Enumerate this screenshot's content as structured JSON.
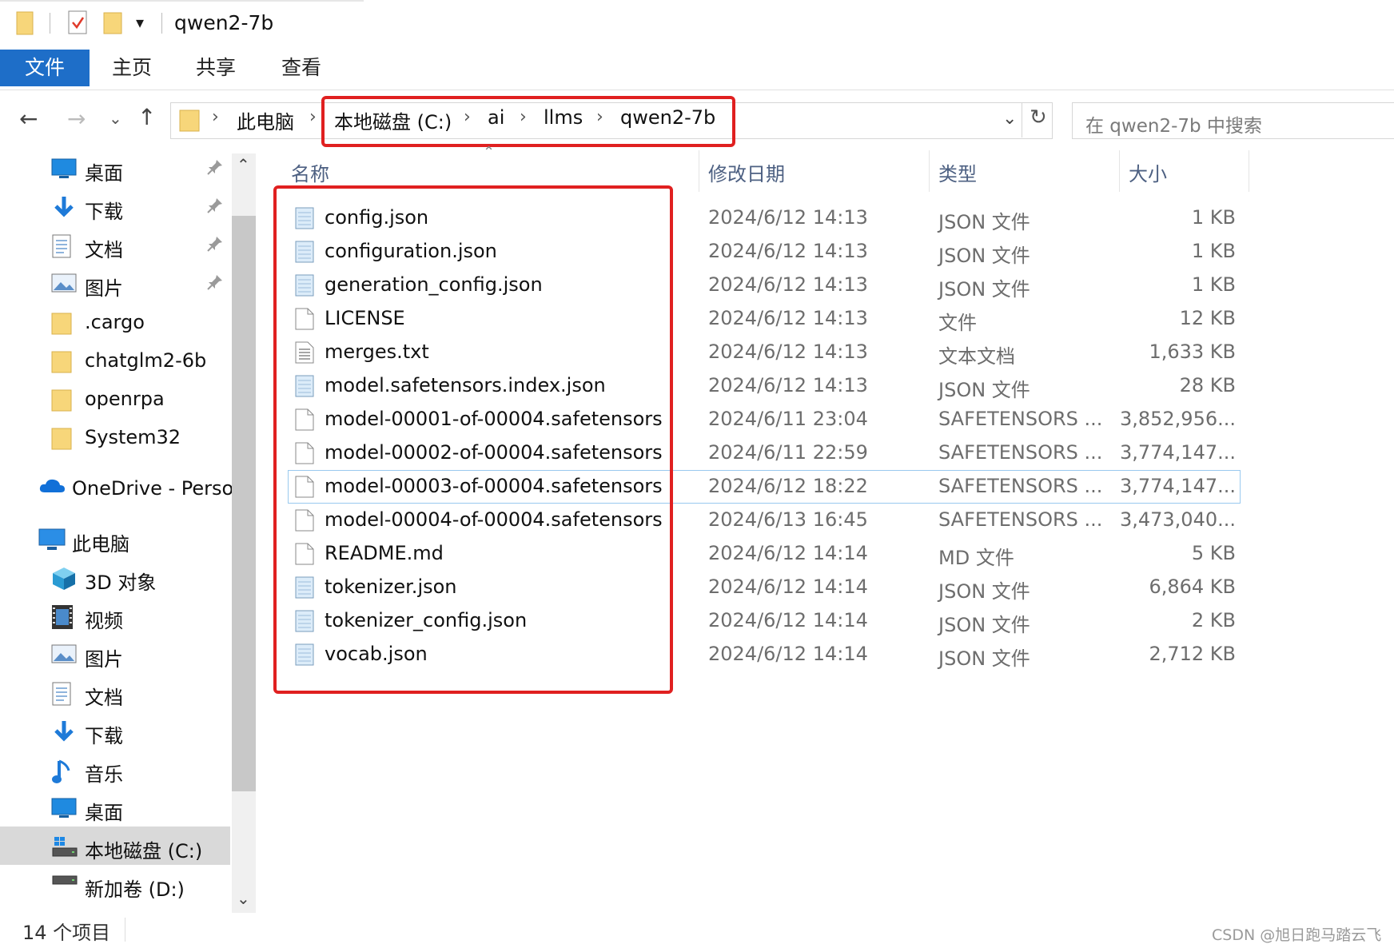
{
  "window": {
    "title": "qwen2-7b"
  },
  "ribbon": {
    "tabs": [
      {
        "label": "文件"
      },
      {
        "label": "主页"
      },
      {
        "label": "共享"
      },
      {
        "label": "查看"
      }
    ]
  },
  "address": {
    "crumbs": [
      "此电脑",
      "本地磁盘 (C:)",
      "ai",
      "llms",
      "qwen2-7b"
    ],
    "search_placeholder": "在 qwen2-7b 中搜索"
  },
  "columns": {
    "name": "名称",
    "date": "修改日期",
    "type": "类型",
    "size": "大小"
  },
  "nav": {
    "quick_access": [
      {
        "label": "桌面",
        "icon": "desktop-icon",
        "pinned": true
      },
      {
        "label": "下载",
        "icon": "download-icon",
        "pinned": true
      },
      {
        "label": "文档",
        "icon": "document-icon",
        "pinned": true
      },
      {
        "label": "图片",
        "icon": "pictures-icon",
        "pinned": true
      },
      {
        "label": ".cargo",
        "icon": "folder-icon",
        "pinned": false
      },
      {
        "label": "chatglm2-6b",
        "icon": "folder-icon",
        "pinned": false
      },
      {
        "label": "openrpa",
        "icon": "folder-icon",
        "pinned": false
      },
      {
        "label": "System32",
        "icon": "folder-icon",
        "pinned": false
      }
    ],
    "onedrive": {
      "label": "OneDrive - Perso",
      "icon": "onedrive-icon"
    },
    "this_pc": {
      "label": "此电脑",
      "icon": "computer-icon"
    },
    "pc_items": [
      {
        "label": "3D 对象",
        "icon": "3d-objects-icon"
      },
      {
        "label": "视频",
        "icon": "video-icon"
      },
      {
        "label": "图片",
        "icon": "pictures-icon"
      },
      {
        "label": "文档",
        "icon": "document-icon"
      },
      {
        "label": "下载",
        "icon": "download-icon"
      },
      {
        "label": "音乐",
        "icon": "music-icon"
      },
      {
        "label": "桌面",
        "icon": "desktop-icon"
      },
      {
        "label": "本地磁盘 (C:)",
        "icon": "system-drive-icon",
        "selected": true
      },
      {
        "label": "新加卷 (D:)",
        "icon": "drive-icon"
      }
    ]
  },
  "files": [
    {
      "name": "config.json",
      "date": "2024/6/12 14:13",
      "type": "JSON 文件",
      "size": "1 KB",
      "icon": "json-file-icon"
    },
    {
      "name": "configuration.json",
      "date": "2024/6/12 14:13",
      "type": "JSON 文件",
      "size": "1 KB",
      "icon": "json-file-icon"
    },
    {
      "name": "generation_config.json",
      "date": "2024/6/12 14:13",
      "type": "JSON 文件",
      "size": "1 KB",
      "icon": "json-file-icon"
    },
    {
      "name": "LICENSE",
      "date": "2024/6/12 14:13",
      "type": "文件",
      "size": "12 KB",
      "icon": "blank-file-icon"
    },
    {
      "name": "merges.txt",
      "date": "2024/6/12 14:13",
      "type": "文本文档",
      "size": "1,633 KB",
      "icon": "text-file-icon"
    },
    {
      "name": "model.safetensors.index.json",
      "date": "2024/6/12 14:13",
      "type": "JSON 文件",
      "size": "28 KB",
      "icon": "json-file-icon"
    },
    {
      "name": "model-00001-of-00004.safetensors",
      "date": "2024/6/11 23:04",
      "type": "SAFETENSORS ...",
      "size": "3,852,956...",
      "icon": "blank-file-icon"
    },
    {
      "name": "model-00002-of-00004.safetensors",
      "date": "2024/6/11 22:59",
      "type": "SAFETENSORS ...",
      "size": "3,774,147...",
      "icon": "blank-file-icon"
    },
    {
      "name": "model-00003-of-00004.safetensors",
      "date": "2024/6/12 18:22",
      "type": "SAFETENSORS ...",
      "size": "3,774,147...",
      "icon": "blank-file-icon",
      "focused": true
    },
    {
      "name": "model-00004-of-00004.safetensors",
      "date": "2024/6/13 16:45",
      "type": "SAFETENSORS ...",
      "size": "3,473,040...",
      "icon": "blank-file-icon"
    },
    {
      "name": "README.md",
      "date": "2024/6/12 14:14",
      "type": "MD 文件",
      "size": "5 KB",
      "icon": "blank-file-icon"
    },
    {
      "name": "tokenizer.json",
      "date": "2024/6/12 14:14",
      "type": "JSON 文件",
      "size": "6,864 KB",
      "icon": "json-file-icon"
    },
    {
      "name": "tokenizer_config.json",
      "date": "2024/6/12 14:14",
      "type": "JSON 文件",
      "size": "2 KB",
      "icon": "json-file-icon"
    },
    {
      "name": "vocab.json",
      "date": "2024/6/12 14:14",
      "type": "JSON 文件",
      "size": "2,712 KB",
      "icon": "json-file-icon"
    }
  ],
  "status": {
    "item_count": "14 个项目"
  },
  "watermark": "CSDN @旭日跑马踏云飞",
  "colors": {
    "ribbon_file_tab": "#1e6ec8",
    "highlight_box": "#e02020",
    "header_text": "#4d6082"
  }
}
